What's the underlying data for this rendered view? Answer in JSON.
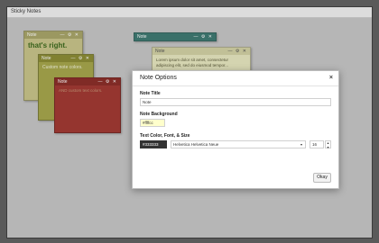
{
  "window": {
    "title": "Sticky Notes"
  },
  "notes": [
    {
      "header": "Note",
      "body": "that's right.",
      "bg": "#c8c48a",
      "header_bg": "#a9a56a",
      "text_color": "#3e6b1f"
    },
    {
      "header": "Note",
      "body": "Custom note colors.",
      "bg": "#a6a74c",
      "header_bg": "#8c8d36",
      "text_color": "#f2f2dc"
    },
    {
      "header": "Note",
      "body": "AND custom text colors.",
      "bg": "#a23a34",
      "header_bg": "#8b2f2a",
      "text_color": "#c89a7a"
    },
    {
      "header": "Note",
      "body": "",
      "bg": "#4d8b82",
      "header_bg": "#3f7a72",
      "text_color": "#ffffff"
    },
    {
      "header": "Note",
      "body": "Lorem ipsum dolor sit amet, consectetur adipiscing elit, sed do eiusmod tempor...",
      "bg": "#e7e6bf",
      "header_bg": "#d2d1a4",
      "text_color": "#5a5a3a"
    }
  ],
  "note_controls": "— ⚙ ✕",
  "dialog": {
    "title": "Note Options",
    "close": "×",
    "title_label": "Note Title",
    "title_value": "Note",
    "bg_label": "Note Background",
    "bg_value": "#ffffcc",
    "text_label": "Text Color, Font, & Size",
    "text_color_value": "#333333",
    "font_value": "Helvetica Helvetica Neue",
    "size_value": "16",
    "okay": "Okay"
  },
  "colors": {
    "window_bg": "#c6c6c6",
    "bg_swatch": "#ffffcc",
    "text_swatch": "#333333"
  }
}
